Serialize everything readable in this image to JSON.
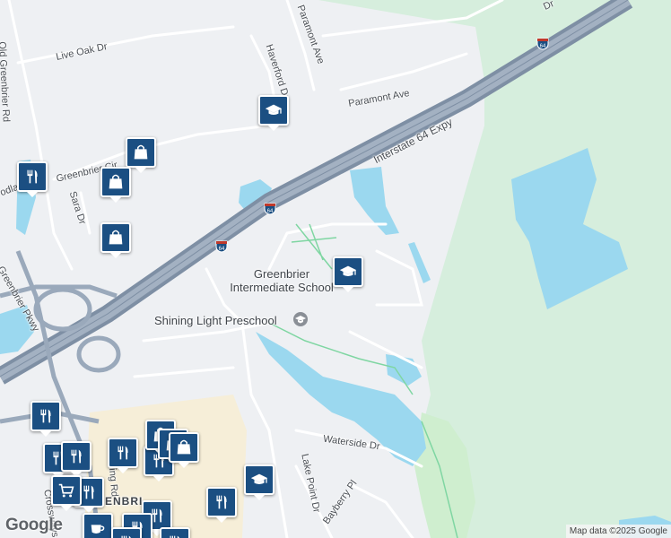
{
  "streets": {
    "old_greenbrier_rd": "Old Greenbrier Rd",
    "live_oak_dr": "Live Oak Dr",
    "haverford_dr": "Haverford Dr",
    "paramont_ave_upper": "Paramont Ave",
    "paramont_ave": "Paramont Ave",
    "interstate": "Interstate 64 Expy",
    "greenbrier_cir": "Greenbrier Cir",
    "sara_dr": "Sara Dr",
    "greenbrier_pkwy": "Greenbrier Pkwy",
    "waterside_dr": "Waterside Dr",
    "lake_point_dr": "Lake Point Dr",
    "bayberry_pl": "Bayberry Pl",
    "kling_rd": "Kling Rd",
    "crossways": "Crossways",
    "edge_left": "odla",
    "edge_top": "Dr"
  },
  "places": {
    "greenbrier_intermediate": "Greenbrier Intermediate School",
    "shining_light": "Shining Light Preschool",
    "greenbrier_area": "GREENBRI"
  },
  "shields": {
    "route": "64"
  },
  "icons": {
    "school": "graduation-cap-icon",
    "restaurant": "fork-knife-icon",
    "shopping": "shopping-bag-icon",
    "cart": "shopping-cart-icon",
    "cafe": "coffee-cup-icon"
  },
  "colors": {
    "marker": "#1b4f82",
    "water": "#9bd8ef",
    "park": "#d6eedd",
    "highway": "#8a9bb0",
    "commercial": "#f6eed8"
  },
  "attribution": "Map data ©2025 Google",
  "logo": "Google"
}
